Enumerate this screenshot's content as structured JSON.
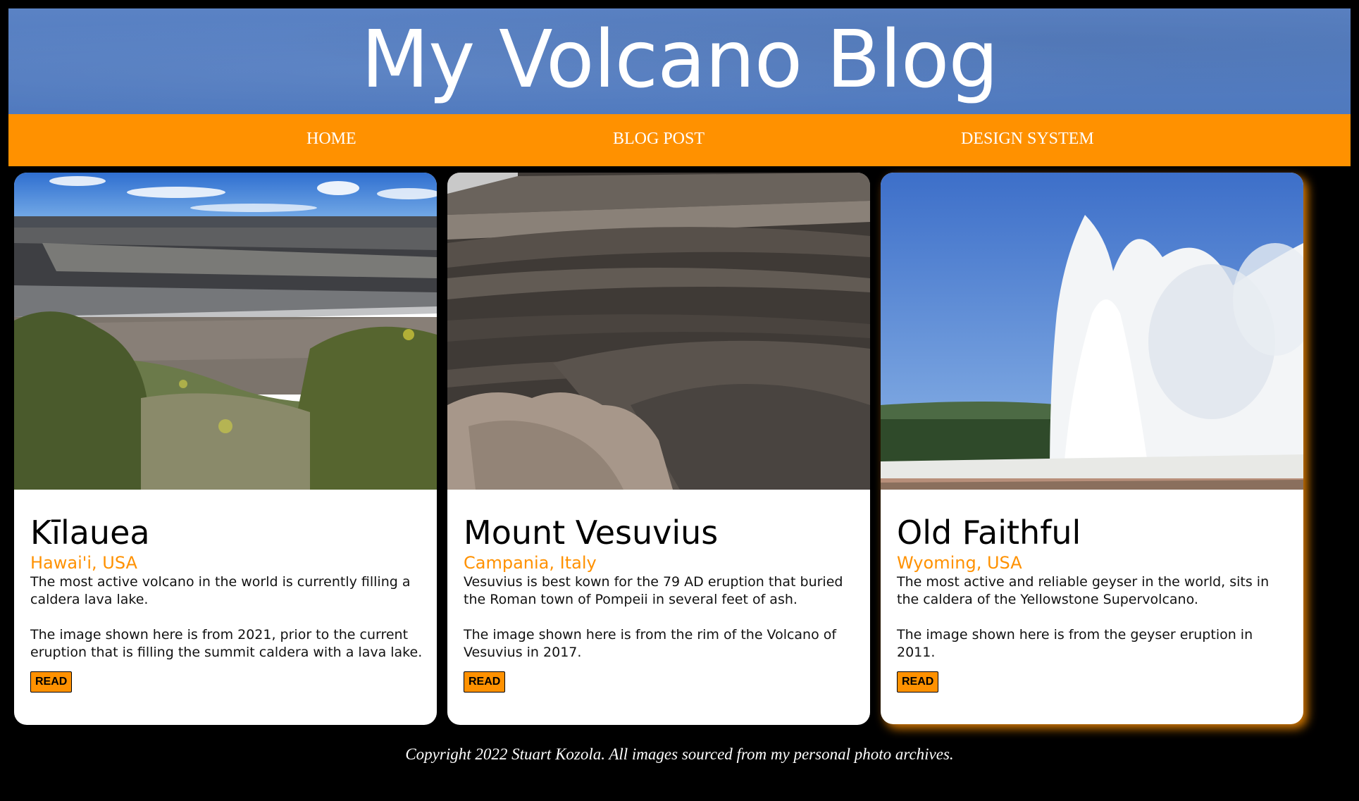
{
  "site": {
    "title": "My Volcano Blog"
  },
  "nav": {
    "items": [
      {
        "label": "HOME"
      },
      {
        "label": "BLOG POST"
      },
      {
        "label": "DESIGN SYSTEM"
      }
    ]
  },
  "cards": [
    {
      "title": "Kīlauea",
      "location": "Hawai'i, USA",
      "paragraphs": [
        "The most active volcano in the world is currently filling a caldera lava lake.",
        "The image shown here is from 2021, prior to the current eruption that is filling the summit caldera with a lava lake."
      ],
      "button": "READ"
    },
    {
      "title": "Mount Vesuvius",
      "location": "Campania, Italy",
      "paragraphs": [
        "Vesuvius is best kown for the 79 AD eruption that buried the Roman town of Pompeii in several feet of ash.",
        "The image shown here is from the rim of the Volcano of Vesuvius in 2017."
      ],
      "button": "READ"
    },
    {
      "title": "Old Faithful",
      "location": "Wyoming, USA",
      "paragraphs": [
        "The most active and reliable geyser in the world, sits in the caldera of the Yellowstone Supervolcano.",
        "The image shown here is from the geyser eruption in 2011."
      ],
      "button": "READ"
    }
  ],
  "footer": {
    "text": "Copyright 2022 Stuart Kozola. All images sourced from my personal photo archives."
  },
  "colors": {
    "accent": "#ff9100",
    "header": "#4f79be",
    "background": "#000000"
  }
}
